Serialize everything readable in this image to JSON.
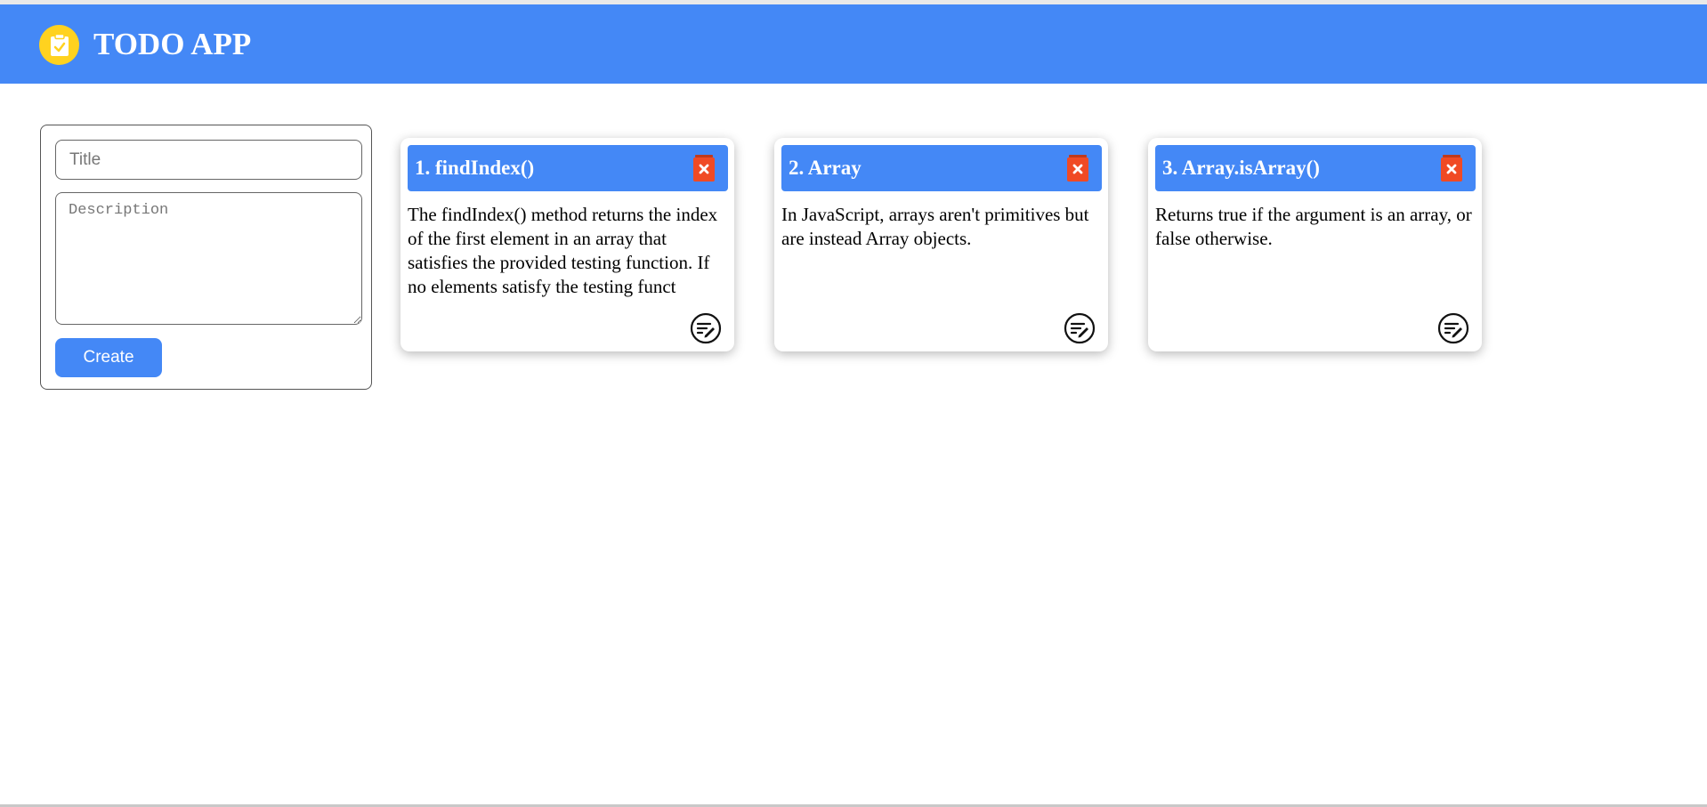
{
  "app": {
    "title": "TODO APP",
    "logo_icon": "clipboard-check-icon",
    "accent_color": "#4488f6",
    "logo_color": "#ffd21f"
  },
  "form": {
    "title_placeholder": "Title",
    "title_value": "",
    "description_placeholder": "Description",
    "description_value": "",
    "create_label": "Create"
  },
  "cards": [
    {
      "title": "1. findIndex()",
      "description": "The findIndex() method returns the index of the first element in an array that satisfies the provided testing function. If no elements satisfy the testing funct",
      "delete_icon": "trash-icon",
      "edit_icon": "edit-note-icon"
    },
    {
      "title": "2. Array",
      "description": "In JavaScript, arrays aren't primitives but are instead Array objects.",
      "delete_icon": "trash-icon",
      "edit_icon": "edit-note-icon"
    },
    {
      "title": "3. Array.isArray()",
      "description": "Returns true if the argument is an array, or false otherwise.",
      "delete_icon": "trash-icon",
      "edit_icon": "edit-note-icon"
    }
  ],
  "colors": {
    "delete_red": "#f04a24"
  }
}
